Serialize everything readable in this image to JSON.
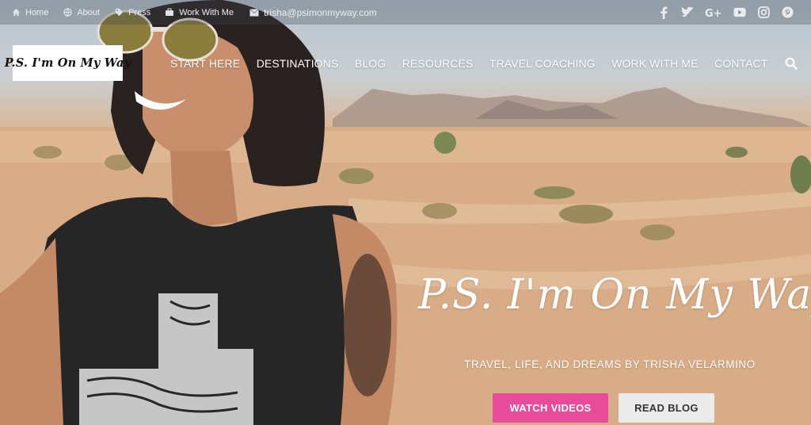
{
  "topbar": {
    "links": [
      {
        "label": "Home",
        "icon": "home-icon"
      },
      {
        "label": "About",
        "icon": "globe-icon"
      },
      {
        "label": "Press",
        "icon": "tag-icon"
      },
      {
        "label": "Work With Me",
        "icon": "briefcase-icon"
      }
    ],
    "email": {
      "label": "trisha@psimonmyway.com",
      "icon": "envelope-icon"
    },
    "social": [
      "facebook-icon",
      "twitter-icon",
      "google-plus-icon",
      "youtube-icon",
      "instagram-icon",
      "pinterest-icon"
    ]
  },
  "logo": {
    "text": "P.S. I'm On My Way"
  },
  "nav": {
    "items": [
      "START HERE",
      "DESTINATIONS",
      "BLOG",
      "RESOURCES",
      "TRAVEL COACHING",
      "WORK WITH ME",
      "CONTACT"
    ],
    "search_icon": "search-icon"
  },
  "hero": {
    "title": "P.S. I'm On My Way",
    "subtitle": "TRAVEL, LIFE, AND DREAMS BY TRISHA VELARMINO",
    "buttons": {
      "watch": "WATCH VIDEOS",
      "read": "READ BLOG"
    }
  },
  "colors": {
    "accent": "#e74b9a",
    "secondary_button": "#ebebeb"
  }
}
